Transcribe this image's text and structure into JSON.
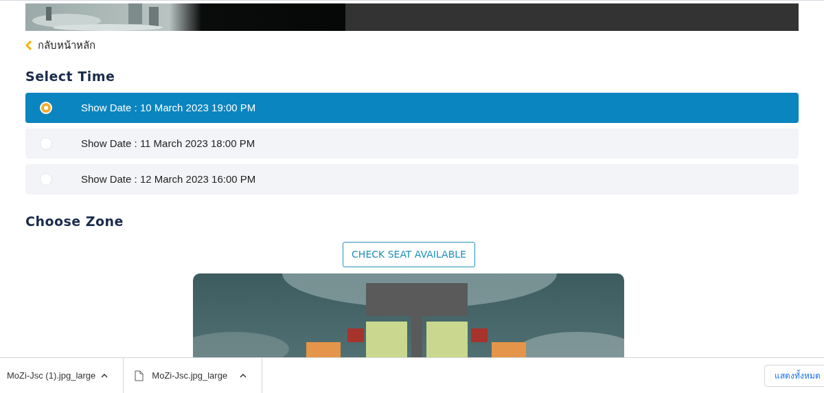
{
  "back_link": {
    "label": "กลับหน้าหลัก"
  },
  "select_time": {
    "heading": "Select Time",
    "options": [
      {
        "label": "Show Date : 10 March 2023 19:00 PM",
        "selected": true
      },
      {
        "label": "Show Date : 11 March 2023 18:00 PM",
        "selected": false
      },
      {
        "label": "Show Date : 12 March 2023 16:00 PM",
        "selected": false
      }
    ]
  },
  "choose_zone": {
    "heading": "Choose Zone",
    "button": "CHECK SEAT AVAILABLE"
  },
  "download_bar": {
    "items": [
      {
        "name": "MoZi-Jsc (1).jpg_large",
        "file_icon": false
      },
      {
        "name": "MoZi-Jsc.jpg_large",
        "file_icon": true
      }
    ],
    "show_all": "แสดงทั้งหมด"
  }
}
